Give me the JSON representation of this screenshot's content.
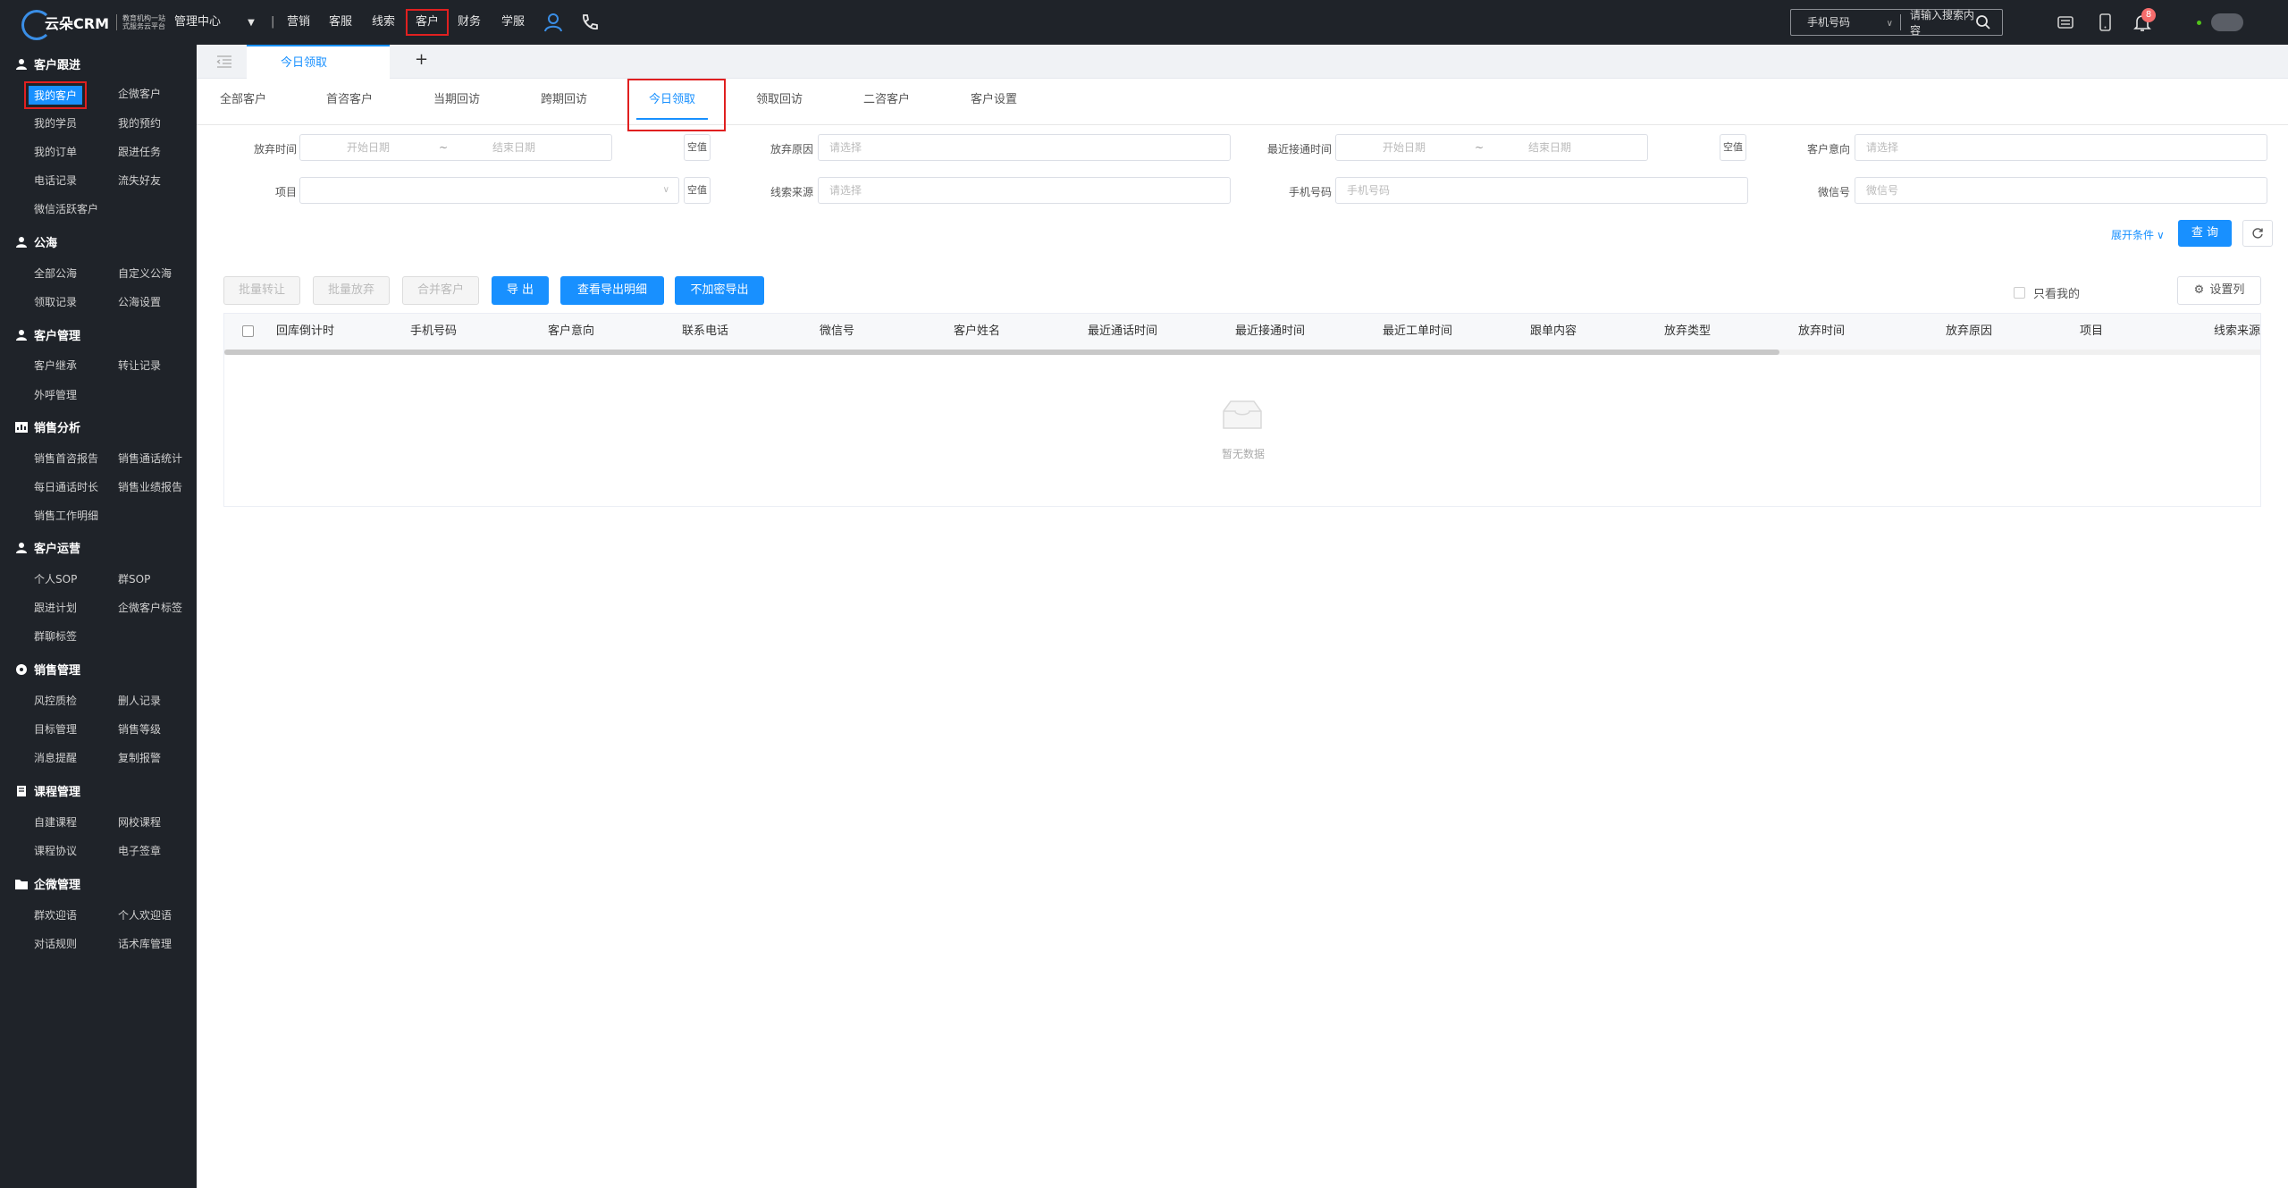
{
  "topbar": {
    "logo_text": "云朵CRM",
    "logo_slogan_1": "教育机构一站",
    "logo_slogan_2": "式服务云平台",
    "management_center": "管理中心",
    "nav_items": [
      "营销",
      "客服",
      "线索",
      "客户",
      "财务",
      "学服"
    ],
    "search_type": "手机号码",
    "search_placeholder": "请输入搜索内容",
    "notification_count": "8"
  },
  "sidebar": {
    "sections": [
      {
        "title": "客户跟进",
        "icon": "user-icon",
        "items": [
          "我的客户",
          "企微客户",
          "我的学员",
          "我的预约",
          "我的订单",
          "跟进任务",
          "电话记录",
          "流失好友",
          "微信活跃客户"
        ]
      },
      {
        "title": "公海",
        "icon": "user-icon",
        "items": [
          "全部公海",
          "自定义公海",
          "领取记录",
          "公海设置"
        ]
      },
      {
        "title": "客户管理",
        "icon": "user-icon",
        "items": [
          "客户继承",
          "转让记录",
          "外呼管理"
        ]
      },
      {
        "title": "销售分析",
        "icon": "chart-icon",
        "items": [
          "销售首咨报告",
          "销售通话统计",
          "每日通话时长",
          "销售业绩报告",
          "销售工作明细"
        ]
      },
      {
        "title": "客户运营",
        "icon": "user-icon",
        "items": [
          "个人SOP",
          "群SOP",
          "跟进计划",
          "企微客户标签",
          "群聊标签"
        ]
      },
      {
        "title": "销售管理",
        "icon": "gear-icon",
        "items": [
          "风控质检",
          "删人记录",
          "目标管理",
          "销售等级",
          "消息提醒",
          "复制报警"
        ]
      },
      {
        "title": "课程管理",
        "icon": "book-icon",
        "items": [
          "自建课程",
          "网校课程",
          "课程协议",
          "电子签章"
        ]
      },
      {
        "title": "企微管理",
        "icon": "folder-icon",
        "items": [
          "群欢迎语",
          "个人欢迎语",
          "对话规则",
          "话术库管理"
        ]
      }
    ]
  },
  "tabstrip": {
    "open_tab": "今日领取",
    "add": "+"
  },
  "subtabs": [
    "全部客户",
    "首咨客户",
    "当期回访",
    "跨期回访",
    "今日领取",
    "领取回访",
    "二咨客户",
    "客户设置"
  ],
  "filters": {
    "abandon_time": "放弃时间",
    "start_date": "开始日期",
    "end_date": "结束日期",
    "range_sep": "~",
    "empty_value": "空值",
    "abandon_reason": "放弃原因",
    "please_select": "请选择",
    "last_connect_time": "最近接通时间",
    "customer_intent": "客户意向",
    "project": "项目",
    "lead_source": "线索来源",
    "phone": "手机号码",
    "phone_placeholder": "手机号码",
    "wechat": "微信号",
    "wechat_placeholder": "微信号",
    "expand": "展开条件",
    "query": "查 询"
  },
  "toolbar": {
    "batch_transfer": "批量转让",
    "batch_abandon": "批量放弃",
    "merge_customer": "合并客户",
    "export": "导 出",
    "view_export_detail": "查看导出明细",
    "export_unencrypted": "不加密导出",
    "only_mine": "只看我的",
    "set_columns": "设置列"
  },
  "table": {
    "columns": [
      "回库倒计时",
      "手机号码",
      "客户意向",
      "联系电话",
      "微信号",
      "客户姓名",
      "最近通话时间",
      "最近接通时间",
      "最近工单时间",
      "跟单内容",
      "放弃类型",
      "放弃时间",
      "放弃原因",
      "项目",
      "线索来源"
    ],
    "empty_text": "暂无数据"
  },
  "colors": {
    "accent": "#1890ff",
    "sidebar_bg": "#1f2329",
    "highlight": "#e02020",
    "badge": "#f56c6c"
  }
}
